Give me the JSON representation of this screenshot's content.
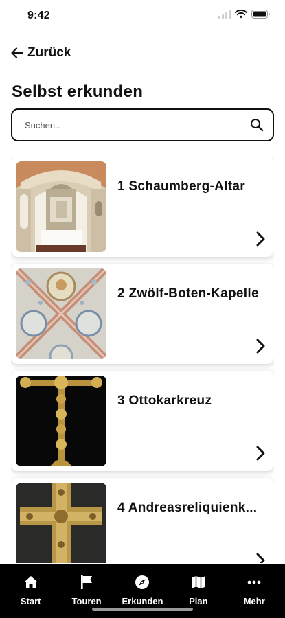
{
  "status_bar": {
    "time": "9:42"
  },
  "nav": {
    "back_label": "Zurück"
  },
  "page": {
    "title": "Selbst erkunden"
  },
  "search": {
    "placeholder": "Suchen..",
    "value": ""
  },
  "items": [
    {
      "title": "1 Schaumberg-Altar",
      "image": "altar-chapel-photo"
    },
    {
      "title": "2 Zwölf-Boten-Kapelle",
      "image": "painted-vault-ceiling-photo"
    },
    {
      "title": "3 Ottokarkreuz",
      "image": "golden-cross-photo"
    },
    {
      "title": "4 Andreasreliquienk...",
      "image": "reliquary-cross-photo"
    }
  ],
  "tab_bar": {
    "tabs": [
      {
        "label": "Start",
        "icon": "home-icon"
      },
      {
        "label": "Touren",
        "icon": "flag-icon"
      },
      {
        "label": "Erkunden",
        "icon": "compass-icon"
      },
      {
        "label": "Plan",
        "icon": "map-icon"
      },
      {
        "label": "Mehr",
        "icon": "more-dots-icon"
      }
    ]
  },
  "colors": {
    "text": "#111111",
    "tab_bar_bg": "#000000",
    "tab_fg": "#ffffff",
    "card_bg": "#ffffff"
  }
}
